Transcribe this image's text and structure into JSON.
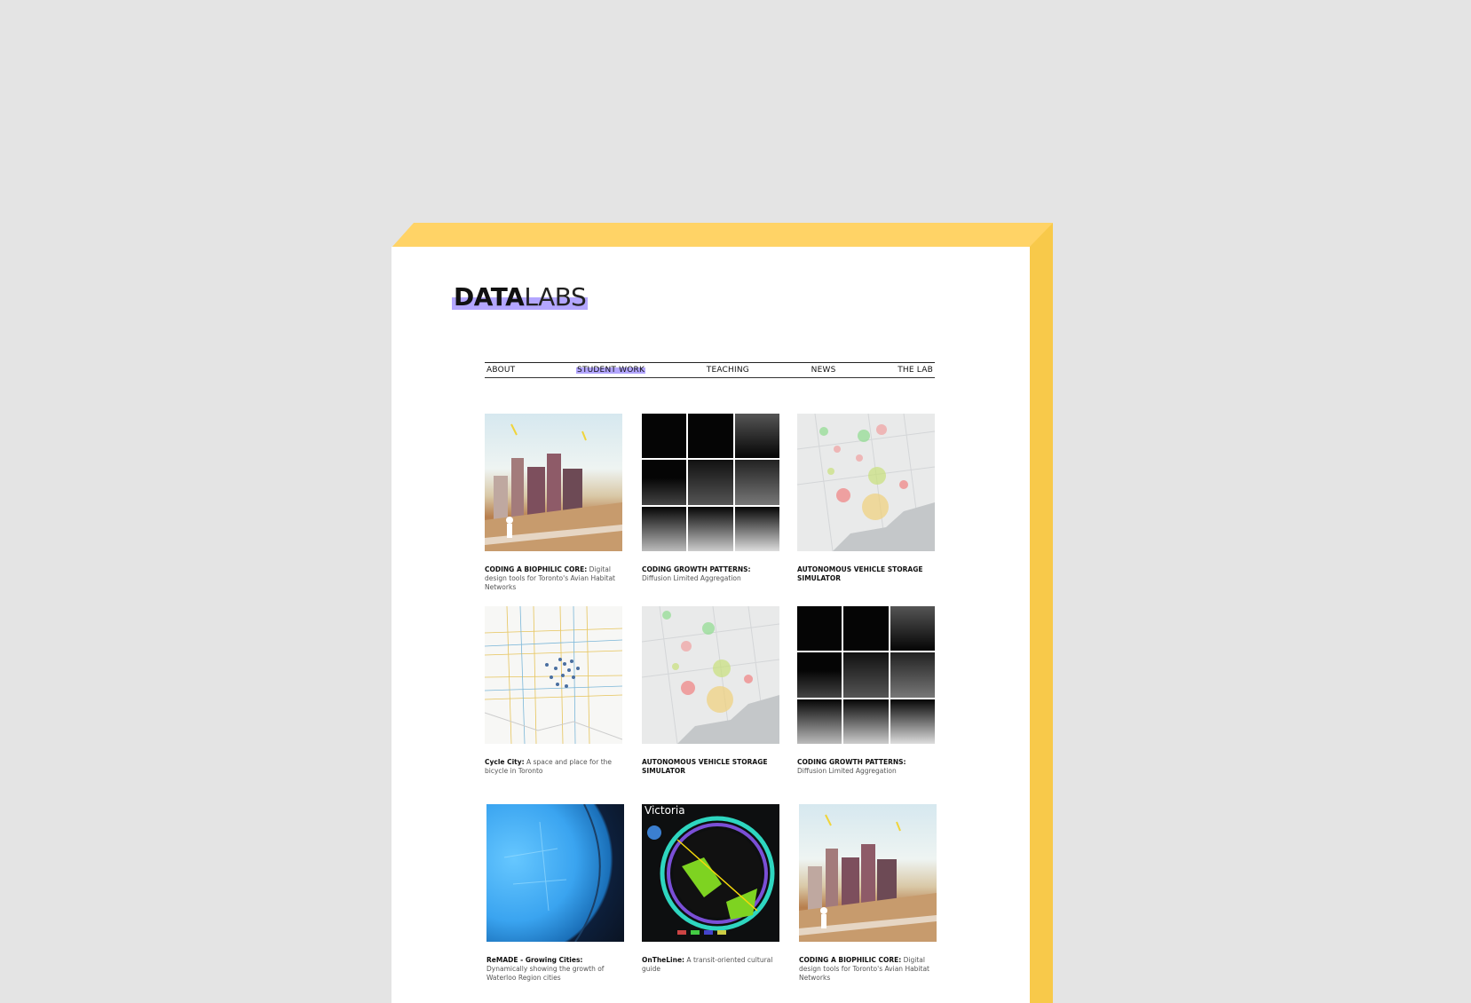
{
  "logo": {
    "bold": "DATA",
    "light": "LABS"
  },
  "nav": [
    {
      "label": "ABOUT"
    },
    {
      "label": "STUDENT WORK",
      "active": true
    },
    {
      "label": "TEACHING"
    },
    {
      "label": "NEWS"
    },
    {
      "label": "THE LAB"
    }
  ],
  "projects": [
    {
      "title": "CODING A BIOPHILIC CORE:",
      "desc": " Digital design tools for Toronto's Avian Habitat Networks",
      "thumb": "biophilic"
    },
    {
      "title": "CODING GROWTH PATTERNS:",
      "desc": " Diffusion Limited Aggregation",
      "thumb": "growth"
    },
    {
      "title": "AUTONOMOUS VEHICLE STORAGE SIMULATOR",
      "desc": "",
      "thumb": "map"
    },
    {
      "title": "Cycle City:",
      "desc": " A space and place for the bicycle in Toronto",
      "thumb": "cycle"
    },
    {
      "title": "AUTONOMOUS VEHICLE STORAGE SIMULATOR",
      "desc": "",
      "thumb": "map"
    },
    {
      "title": "CODING GROWTH PATTERNS:",
      "desc": " Diffusion Limited Aggregation",
      "thumb": "growth"
    },
    {
      "title": "ReMADE - Growing Cities:",
      "desc": " Dynamically showing the growth of Waterloo Region cities",
      "thumb": "remade"
    },
    {
      "title": "OnTheLine:",
      "desc": " A transit-oriented cultural guide",
      "thumb": "victoria"
    },
    {
      "title": "CODING A BIOPHILIC CORE:",
      "desc": " Digital design tools for Toronto's Avian Habitat Networks",
      "thumb": "biophilic"
    }
  ],
  "victoria_label": "Victoria",
  "colors": {
    "accent": "#b3a6ff",
    "card_yellow": "#ffd366"
  }
}
